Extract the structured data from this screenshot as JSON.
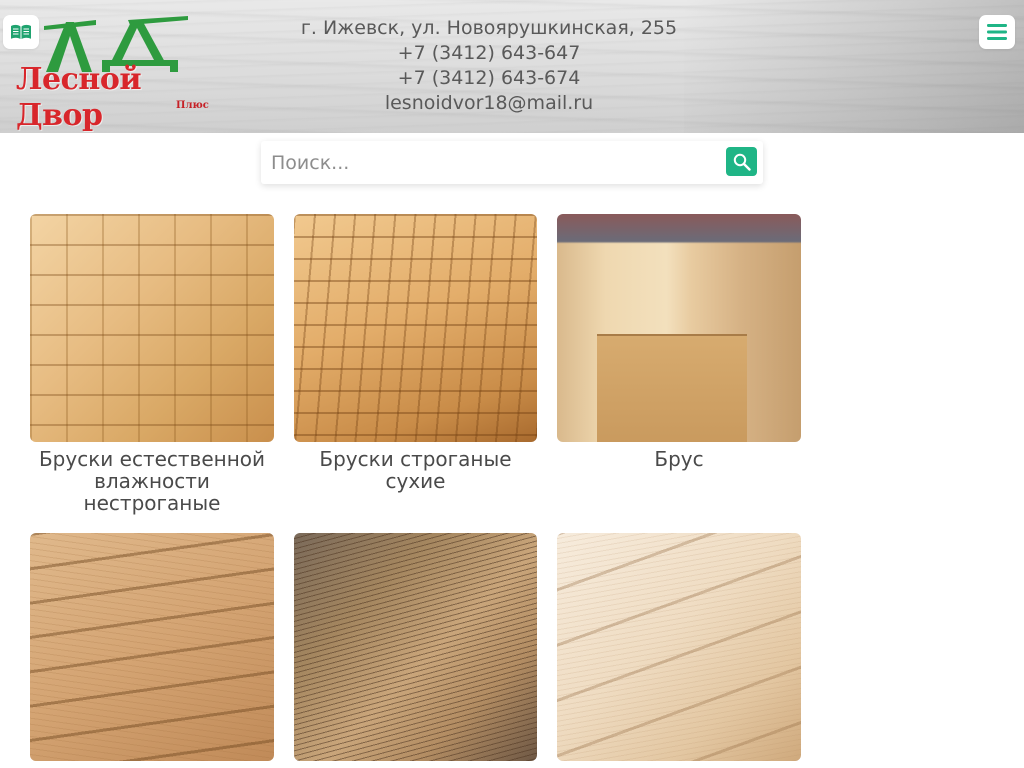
{
  "header": {
    "logo": {
      "name": "Лесной Двор",
      "suffix": "Плюс",
      "mark": "ЛД"
    },
    "contacts": {
      "address": "г. Ижевск, ул. Новоярушкинская, 255",
      "phone_1": "+7 (3412) 643-647",
      "phone_2": "+7 (3412) 643-674",
      "email": "lesnoidvor18@mail.ru"
    },
    "icons": {
      "left": "open-book-icon",
      "right": "hamburger-menu-icon"
    }
  },
  "search": {
    "placeholder": "Поиск...",
    "value": "",
    "button_icon": "search-icon"
  },
  "products": [
    {
      "title": "Бруски естественной влажности нестроганые",
      "image": "stacked-rough-bars"
    },
    {
      "title": "Бруски строганые сухие",
      "image": "stacked-planed-bars"
    },
    {
      "title": "Брус",
      "image": "timber-beam"
    },
    {
      "title": "",
      "image": "stacked-boards"
    },
    {
      "title": "",
      "image": "plywood-sheets"
    },
    {
      "title": "",
      "image": "tongue-groove-lining"
    }
  ],
  "colors": {
    "accent": "#1fb586",
    "logo_red": "#d8262b",
    "logo_green": "#2e9b3f",
    "text": "#4a4a4a"
  }
}
